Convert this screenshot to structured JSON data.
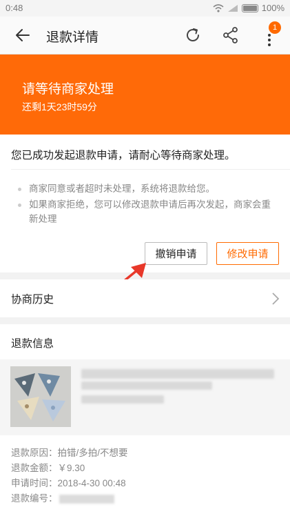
{
  "status_bar": {
    "time": "0:48",
    "battery": "100%"
  },
  "header": {
    "title": "退款详情",
    "notification_count": "1"
  },
  "banner": {
    "title": "请等待商家处理",
    "countdown": "还剩1天23时59分"
  },
  "status_card": {
    "message": "您已成功发起退款申请，请耐心等待商家处理。",
    "tips": [
      "商家同意或者超时未处理，系统将退款给您。",
      "如果商家拒绝，您可以修改退款申请后再次发起，商家会重新处理"
    ],
    "cancel_label": "撤销申请",
    "modify_label": "修改申请"
  },
  "history": {
    "label": "协商历史"
  },
  "refund_info": {
    "label": "退款信息",
    "reason_label": "退款原因：",
    "reason": "拍错/多拍/不想要",
    "amount_label": "退款金额：",
    "amount": "￥9.30",
    "time_label": "申请时间：",
    "time": "2018-4-30 00:48",
    "number_label": "退款编号："
  },
  "colors": {
    "accent": "#ff6a00",
    "banner": "#ff6a08"
  },
  "icons": [
    "back-arrow-icon",
    "refresh-icon",
    "share-icon",
    "more-icon",
    "chevron-right-icon"
  ]
}
